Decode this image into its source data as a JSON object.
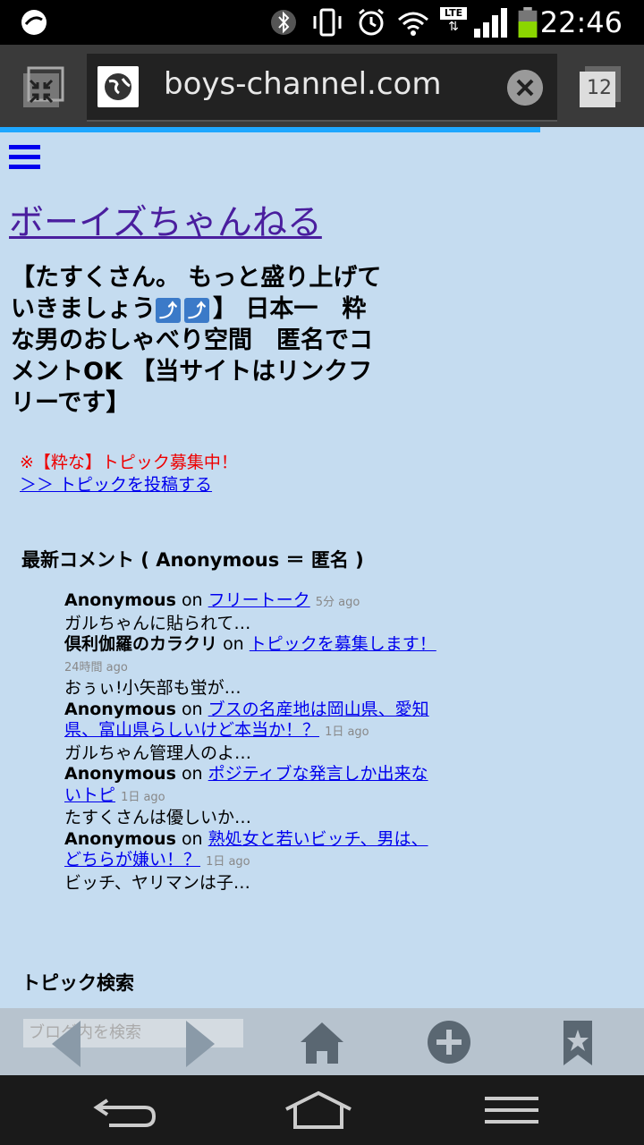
{
  "status": {
    "time": "22:46",
    "network": "LTE"
  },
  "browser": {
    "url": "boys-channel.com",
    "tab_count": "12"
  },
  "site": {
    "title": "ボーイズちゃんねる",
    "tagline_part1": "【たすくさん。 もっと盛り上げていきましょう",
    "arrow1": "⤴",
    "arrow2": "⤴",
    "tagline_part2": "】 日本一　粋な男のおしゃべり空間　匿名でコメントOK 【当サイトはリンクフリーです】",
    "notice": "※【粋な】トピック募集中！",
    "post_link": "＞＞ トピックを投稿する",
    "latest_comments_title": "最新コメント ( Anonymous ＝ 匿名 )",
    "search_title": "トピック検索",
    "search_placeholder": "ブログ内を検索"
  },
  "comments": [
    {
      "author": "Anonymous",
      "on": "on",
      "topic": "フリートーク",
      "ago": "5分 ago",
      "excerpt": "ガルちゃんに貼られて…"
    },
    {
      "author": "倶利伽羅のカラクリ",
      "on": "on",
      "topic": "トピックを募集します！",
      "ago": "24時間 ago",
      "excerpt": "おぅぃ!小矢部も蛍が…"
    },
    {
      "author": "Anonymous",
      "on": "on",
      "topic": "ブスの名産地は岡山県、愛知県、富山県らしいけど本当か！？",
      "ago": "1日 ago",
      "excerpt": "ガルちゃん管理人のよ…"
    },
    {
      "author": "Anonymous",
      "on": "on",
      "topic": "ポジティブな発言しか出来ないトピ",
      "ago": "1日 ago",
      "excerpt": "たすくさんは優しいか…"
    },
    {
      "author": "Anonymous",
      "on": "on",
      "topic": "熟処女と若いビッチ、男は、どちらが嫌い！？",
      "ago": "1日 ago",
      "excerpt": "ビッチ、ヤリマンは子…"
    }
  ],
  "icons": {
    "accent": "#1ea7ff",
    "link": "#0000ee",
    "title": "#4a1e9e",
    "notice": "#ee0000"
  }
}
